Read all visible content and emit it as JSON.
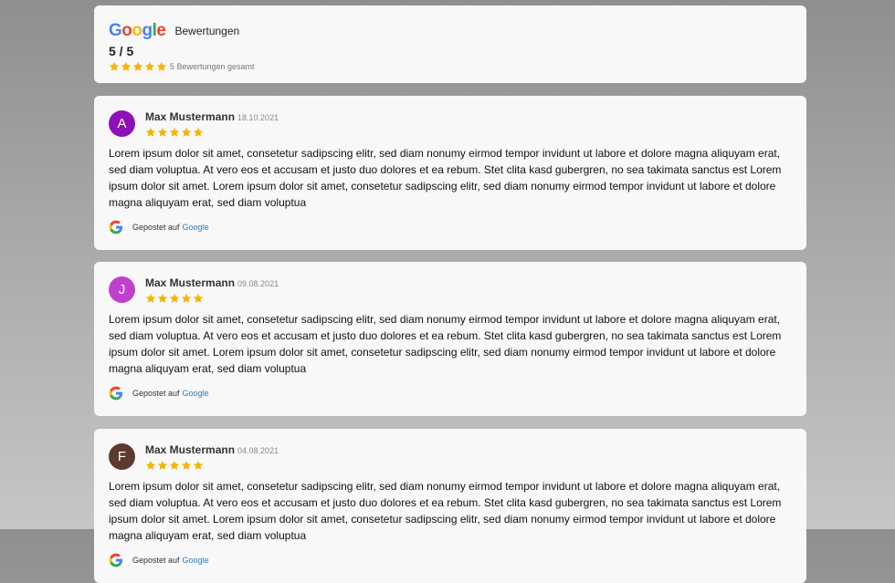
{
  "summary": {
    "logo_text": [
      "G",
      "o",
      "o",
      "g",
      "l",
      "e"
    ],
    "title": "Bewertungen",
    "score": "5 / 5",
    "rating": 5,
    "total_label": "5 Bewertungen gesamt"
  },
  "colors": {
    "star": "#f6b400",
    "google_blue": "#4285f4",
    "google_red": "#ea4335",
    "google_yellow": "#fbbc05",
    "google_green": "#34a853",
    "link": "#2a7ac7"
  },
  "reviews": [
    {
      "initial": "A",
      "avatar_color": "#8e10b8",
      "name": "Max Mustermann",
      "date": "18.10.2021",
      "rating": 5,
      "text": "Lorem ipsum dolor sit amet, consetetur sadipscing elitr, sed diam nonumy eirmod tempor invidunt ut labore et dolore magna aliquyam erat, sed diam voluptua. At vero eos et accusam et justo duo dolores et ea rebum. Stet clita kasd gubergren, no sea takimata sanctus est Lorem ipsum dolor sit amet. Lorem ipsum dolor sit amet, consetetur sadipscing elitr, sed diam nonumy eirmod tempor invidunt ut labore et dolore magna aliquyam erat, sed diam voluptua",
      "posted_prefix": "Gepostet auf",
      "posted_link": "Google",
      "icon": "google-g-icon"
    },
    {
      "initial": "J",
      "avatar_color": "#c13fcf",
      "name": "Max Mustermann",
      "date": "09.08.2021",
      "rating": 5,
      "text": "Lorem ipsum dolor sit amet, consetetur sadipscing elitr, sed diam nonumy eirmod tempor invidunt ut labore et dolore magna aliquyam erat, sed diam voluptua. At vero eos et accusam et justo duo dolores et ea rebum. Stet clita kasd gubergren, no sea takimata sanctus est Lorem ipsum dolor sit amet. Lorem ipsum dolor sit amet, consetetur sadipscing elitr, sed diam nonumy eirmod tempor invidunt ut labore et dolore magna aliquyam erat, sed diam voluptua",
      "posted_prefix": "Gepostet auf",
      "posted_link": "Google",
      "icon": "google-g-icon"
    },
    {
      "initial": "F",
      "avatar_color": "#5c3a2e",
      "name": "Max Mustermann",
      "date": "04.08.2021",
      "rating": 5,
      "text": "Lorem ipsum dolor sit amet, consetetur sadipscing elitr, sed diam nonumy eirmod tempor invidunt ut labore et dolore magna aliquyam erat, sed diam voluptua. At vero eos et accusam et justo duo dolores et ea rebum. Stet clita kasd gubergren, no sea takimata sanctus est Lorem ipsum dolor sit amet. Lorem ipsum dolor sit amet, consetetur sadipscing elitr, sed diam nonumy eirmod tempor invidunt ut labore et dolore magna aliquyam erat, sed diam voluptua",
      "posted_prefix": "Gepostet auf",
      "posted_link": "Google",
      "icon": "google-g-icon"
    }
  ]
}
